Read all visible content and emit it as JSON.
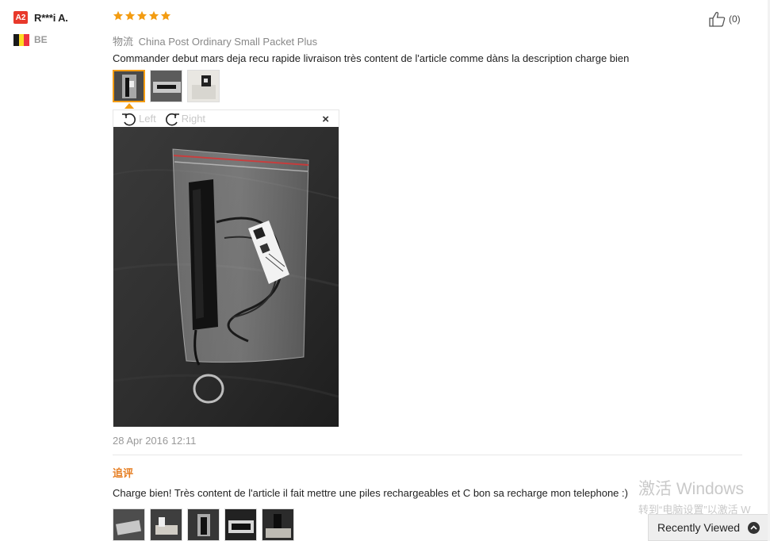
{
  "user": {
    "level": "A2",
    "name": "R***i A.",
    "country_code": "BE"
  },
  "review": {
    "rating_stars": 5,
    "star_color": "#f39c12",
    "logistics_label": "物流",
    "logistics_value": "China Post Ordinary Small Packet Plus",
    "text": "Commander debut mars deja recu rapide livraison très content de l'article comme dàns la description charge bien",
    "useful_count": "(0)",
    "date": "28 Apr 2016 12:11"
  },
  "viewer": {
    "rotate_left_label": "Left",
    "rotate_right_label": "Right",
    "close_label": "×"
  },
  "followup": {
    "label": "追评",
    "text": "Charge bien! Très content de l'article il fait mettre une piles rechargeables et C bon sa recharge mon telephone :)"
  },
  "watermark": {
    "line1": "激活 Windows",
    "line2": "转到“电脑设置”以激活 W"
  },
  "recently_viewed": {
    "label": "Recently Viewed"
  },
  "colors": {
    "accent": "#f39c12",
    "badge": "#e8392b",
    "followup": "#e67e22"
  }
}
